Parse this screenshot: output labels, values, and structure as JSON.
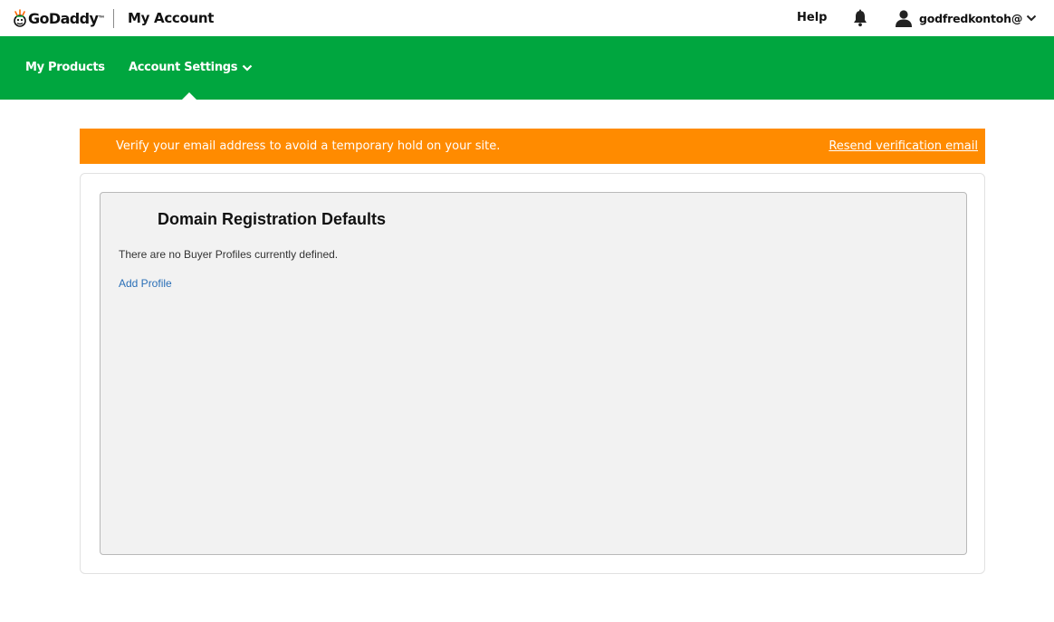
{
  "header": {
    "logo_text": "GoDaddy",
    "logo_tm": "™",
    "title": "My Account",
    "help_label": "Help",
    "username": "godfredkontoh@"
  },
  "nav": {
    "items": [
      {
        "label": "My Products"
      },
      {
        "label": "Account Settings"
      }
    ],
    "active": "Account Settings"
  },
  "alert": {
    "message": "Verify your email address to avoid a temporary hold on your site.",
    "link_label": "Resend verification email"
  },
  "panel": {
    "title": "Domain Registration Defaults",
    "message": "There are no Buyer Profiles currently defined.",
    "add_link": "Add Profile"
  },
  "colors": {
    "nav_green": "#00a63f",
    "alert_orange": "#ff8b00",
    "link_blue": "#2a6fb7"
  },
  "icons": [
    "godaddy-logo-icon",
    "bell-icon",
    "user-icon",
    "chevron-down-icon"
  ]
}
